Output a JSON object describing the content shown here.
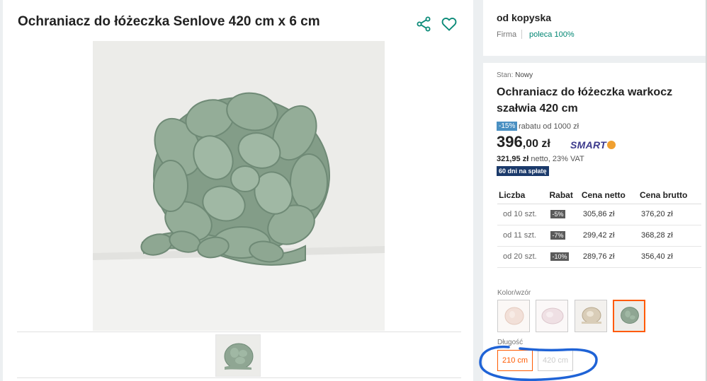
{
  "product": {
    "title": "Ochraniacz do łóżeczka Senlove 420 cm x 6 cm"
  },
  "seller": {
    "name": "od kopyska",
    "type": "Firma",
    "recommendation": "poleca 100%"
  },
  "offer": {
    "state_label": "Stan:",
    "state_value": "Nowy",
    "title": "Ochraniacz do łóżeczka warkocz szałwia 420 cm",
    "discount_badge": "-15%",
    "discount_text": "rabatu od 1000 zł",
    "price_main": "396",
    "price_decimal": ",00 zł",
    "smart_label": "SMART",
    "net_price": "321,95 zł",
    "net_text": "netto, 23% VAT",
    "pay_badge": "60 dni na spłatę"
  },
  "rates_table": {
    "headers": [
      "Liczba",
      "Rabat",
      "Cena netto",
      "Cena brutto"
    ],
    "rows": [
      {
        "qty": "od 10 szt.",
        "discount": "-5%",
        "net": "305,86 zł",
        "gross": "376,20 zł"
      },
      {
        "qty": "od 11 szt.",
        "discount": "-7%",
        "net": "299,42 zł",
        "gross": "368,28 zł"
      },
      {
        "qty": "od 20 szt.",
        "discount": "-10%",
        "net": "289,76 zł",
        "gross": "356,40 zł"
      }
    ]
  },
  "variants": {
    "color_label": "Kolor/wzór",
    "colors": [
      "#f2e0d8",
      "#efe0e4",
      "#d9cdb8",
      "#9fae9a"
    ],
    "selected_color_index": 3,
    "length_label": "Długość",
    "lengths": [
      "210 cm",
      "420 cm"
    ]
  },
  "colors": {
    "accent": "#ff5a00",
    "sage": "#8fa693",
    "teal": "#008673",
    "annotation": "#1f63d6"
  }
}
